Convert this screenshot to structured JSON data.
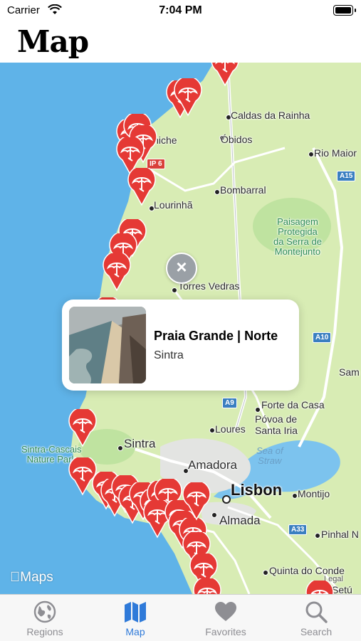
{
  "status_bar": {
    "carrier": "Carrier",
    "time": "7:04 PM"
  },
  "header": {
    "title": "Map"
  },
  "map": {
    "labels": {
      "caldas": "Caldas da Rainha",
      "obidos": "Óbidos",
      "peniche": "Peniche",
      "rio_maior": "Rio Maior",
      "bombarral": "Bombarral",
      "lourinha": "Lourinhã",
      "paisagem": "Paisagem\nProtegida\nda Serra de\nMontejunto",
      "torres_vedras": "Torres Vedras",
      "forte_da_casa": "Forte da Casa",
      "povoa": "Póvoa de\nSanta Iria",
      "loures": "Loures",
      "sea_of_straw": "Sea of\nStraw",
      "sintra": "Sintra",
      "sintra_park": "Sintra-Cascais\nNature Park",
      "amadora": "Amadora",
      "lisbon": "Lisbon",
      "montijo": "Montijo",
      "almada": "Almada",
      "pinhal": "Pinhal N",
      "quinta": "Quinta do Conde",
      "setubal": "Setú",
      "sam": "Sam",
      "legal": "Legal"
    },
    "shields": {
      "ip6": "IP 6",
      "a15": "A15",
      "a10": "A10",
      "a9": "A9",
      "a33": "A33"
    },
    "maps_brand": "Maps",
    "pin_icon": "beach-umbrella-icon",
    "pin_color": "#e53935"
  },
  "selected_beach": {
    "name": "Praia Grande | Norte",
    "region": "Sintra"
  },
  "tabs": [
    {
      "label": "Regions",
      "icon": "globe-icon",
      "active": false
    },
    {
      "label": "Map",
      "icon": "map-icon",
      "active": true
    },
    {
      "label": "Favorites",
      "icon": "heart-icon",
      "active": false
    },
    {
      "label": "Search",
      "icon": "magnifier-icon",
      "active": false
    }
  ],
  "colors": {
    "accent": "#2f7ad9",
    "sea": "#5fb3e8",
    "land": "#d8ecb4"
  }
}
